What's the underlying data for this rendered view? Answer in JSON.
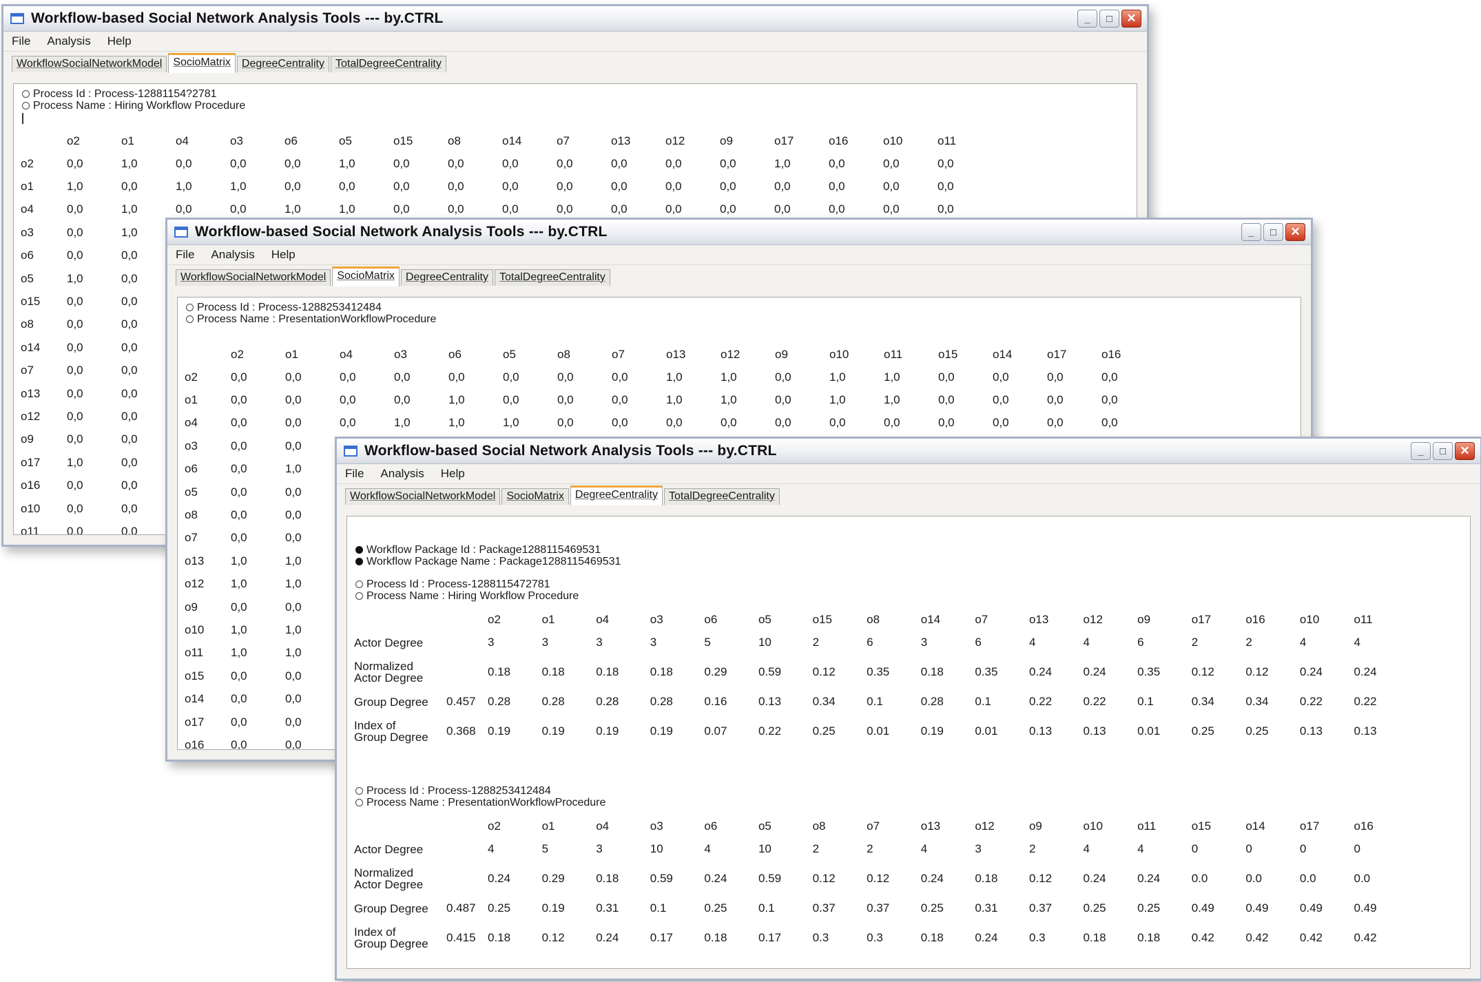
{
  "app": {
    "title": "Workflow-based Social Network Analysis Tools --- by.CTRL",
    "menu": [
      "File",
      "Analysis",
      "Help"
    ],
    "tabs": [
      "WorkflowSocialNetworkModel",
      "SocioMatrix",
      "DegreeCentrality",
      "TotalDegreeCentrality"
    ],
    "controls": {
      "minimize": "_",
      "maximize": "□",
      "close": "✕"
    }
  },
  "window1": {
    "active_tab": "SocioMatrix",
    "process_id_line": "Process Id : Process-12881154?2781",
    "process_name_line": "Process Name : Hiring Workflow Procedure",
    "columns": [
      "o2",
      "o1",
      "o4",
      "o3",
      "o6",
      "o5",
      "o15",
      "o8",
      "o14",
      "o7",
      "o13",
      "o12",
      "o9",
      "o17",
      "o16",
      "o10",
      "o11"
    ],
    "rows": [
      {
        "label": "o2",
        "values": [
          "0,0",
          "1,0",
          "0,0",
          "0,0",
          "0,0",
          "1,0",
          "0,0",
          "0,0",
          "0,0",
          "0,0",
          "0,0",
          "0,0",
          "0,0",
          "1,0",
          "0,0",
          "0,0",
          "0,0"
        ]
      },
      {
        "label": "o1",
        "values": [
          "1,0",
          "0,0",
          "1,0",
          "1,0",
          "0,0",
          "0,0",
          "0,0",
          "0,0",
          "0,0",
          "0,0",
          "0,0",
          "0,0",
          "0,0",
          "0,0",
          "0,0",
          "0,0",
          "0,0"
        ]
      },
      {
        "label": "o4",
        "values": [
          "0,0",
          "1,0",
          "0,0",
          "0,0",
          "1,0",
          "1,0",
          "0,0",
          "0,0",
          "0,0",
          "0,0",
          "0,0",
          "0,0",
          "0,0",
          "0,0",
          "0,0",
          "0,0",
          "0,0"
        ]
      },
      {
        "label": "o3",
        "values": [
          "0,0",
          "1,0"
        ]
      },
      {
        "label": "o6",
        "values": [
          "0,0",
          "0,0"
        ]
      },
      {
        "label": "o5",
        "values": [
          "1,0",
          "0,0"
        ]
      },
      {
        "label": "o15",
        "values": [
          "0,0",
          "0,0"
        ]
      },
      {
        "label": "o8",
        "values": [
          "0,0",
          "0,0"
        ]
      },
      {
        "label": "o14",
        "values": [
          "0,0",
          "0,0"
        ]
      },
      {
        "label": "o7",
        "values": [
          "0,0",
          "0,0"
        ]
      },
      {
        "label": "o13",
        "values": [
          "0,0",
          "0,0"
        ]
      },
      {
        "label": "o12",
        "values": [
          "0,0",
          "0,0"
        ]
      },
      {
        "label": "o9",
        "values": [
          "0,0",
          "0,0"
        ]
      },
      {
        "label": "o17",
        "values": [
          "1,0",
          "0,0"
        ]
      },
      {
        "label": "o16",
        "values": [
          "0,0",
          "0,0"
        ]
      },
      {
        "label": "o10",
        "values": [
          "0,0",
          "0,0"
        ]
      },
      {
        "label": "o11",
        "values": [
          "0,0",
          "0,0"
        ]
      }
    ]
  },
  "window2": {
    "active_tab": "SocioMatrix",
    "process_id_line": "Process Id : Process-1288253412484",
    "process_name_line": "Process Name : PresentationWorkflowProcedure",
    "columns": [
      "o2",
      "o1",
      "o4",
      "o3",
      "o6",
      "o5",
      "o8",
      "o7",
      "o13",
      "o12",
      "o9",
      "o10",
      "o11",
      "o15",
      "o14",
      "o17",
      "o16"
    ],
    "rows": [
      {
        "label": "o2",
        "values": [
          "0,0",
          "0,0",
          "0,0",
          "0,0",
          "0,0",
          "0,0",
          "0,0",
          "0,0",
          "1,0",
          "1,0",
          "0,0",
          "1,0",
          "1,0",
          "0,0",
          "0,0",
          "0,0",
          "0,0"
        ]
      },
      {
        "label": "o1",
        "values": [
          "0,0",
          "0,0",
          "0,0",
          "0,0",
          "1,0",
          "0,0",
          "0,0",
          "0,0",
          "1,0",
          "1,0",
          "0,0",
          "1,0",
          "1,0",
          "0,0",
          "0,0",
          "0,0",
          "0,0"
        ]
      },
      {
        "label": "o4",
        "values": [
          "0,0",
          "0,0",
          "0,0",
          "1,0",
          "1,0",
          "1,0",
          "0,0",
          "0,0",
          "0,0",
          "0,0",
          "0,0",
          "0,0",
          "0,0",
          "0,0",
          "0,0",
          "0,0",
          "0,0"
        ]
      },
      {
        "label": "o3",
        "values": [
          "0,0",
          "0,0"
        ]
      },
      {
        "label": "o6",
        "values": [
          "0,0",
          "1,0"
        ]
      },
      {
        "label": "o5",
        "values": [
          "0,0",
          "0,0"
        ]
      },
      {
        "label": "o8",
        "values": [
          "0,0",
          "0,0"
        ]
      },
      {
        "label": "o7",
        "values": [
          "0,0",
          "0,0"
        ]
      },
      {
        "label": "o13",
        "values": [
          "1,0",
          "1,0"
        ]
      },
      {
        "label": "o12",
        "values": [
          "1,0",
          "1,0"
        ]
      },
      {
        "label": "o9",
        "values": [
          "0,0",
          "0,0"
        ]
      },
      {
        "label": "o10",
        "values": [
          "1,0",
          "1,0"
        ]
      },
      {
        "label": "o11",
        "values": [
          "1,0",
          "1,0"
        ]
      },
      {
        "label": "o15",
        "values": [
          "0,0",
          "0,0"
        ]
      },
      {
        "label": "o14",
        "values": [
          "0,0",
          "0,0"
        ]
      },
      {
        "label": "o17",
        "values": [
          "0,0",
          "0,0"
        ]
      },
      {
        "label": "o16",
        "values": [
          "0,0",
          "0,0"
        ]
      }
    ]
  },
  "window3": {
    "active_tab": "DegreeCentrality",
    "package_id_line": "Workflow Package Id : Package1288115469531",
    "package_name_line": "Workflow Package Name : Package1288115469531",
    "process1": {
      "id_line": "Process Id : Process-1288115472781",
      "name_line": "Process Name : Hiring Workflow Procedure",
      "columns": [
        "o2",
        "o1",
        "o4",
        "o3",
        "o6",
        "o5",
        "o15",
        "o8",
        "o14",
        "o7",
        "o13",
        "o12",
        "o9",
        "o17",
        "o16",
        "o10",
        "o11"
      ],
      "actor_degree_label": "Actor Degree",
      "actor_degree": [
        "3",
        "3",
        "3",
        "3",
        "5",
        "10",
        "2",
        "6",
        "3",
        "6",
        "4",
        "4",
        "6",
        "2",
        "2",
        "4",
        "4"
      ],
      "normalized_label": [
        "Normalized",
        "Actor Degree"
      ],
      "normalized": [
        "0.18",
        "0.18",
        "0.18",
        "0.18",
        "0.29",
        "0.59",
        "0.12",
        "0.35",
        "0.18",
        "0.35",
        "0.24",
        "0.24",
        "0.35",
        "0.12",
        "0.12",
        "0.24",
        "0.24"
      ],
      "group_degree_label": "Group Degree",
      "group_degree_value": "0.457",
      "group_degree": [
        "0.28",
        "0.28",
        "0.28",
        "0.28",
        "0.16",
        "0.13",
        "0.34",
        "0.1",
        "0.28",
        "0.1",
        "0.22",
        "0.22",
        "0.1",
        "0.34",
        "0.34",
        "0.22",
        "0.22"
      ],
      "index_label": [
        "Index of",
        "Group Degree"
      ],
      "index_value": "0.368",
      "index": [
        "0.19",
        "0.19",
        "0.19",
        "0.19",
        "0.07",
        "0.22",
        "0.25",
        "0.01",
        "0.19",
        "0.01",
        "0.13",
        "0.13",
        "0.01",
        "0.25",
        "0.25",
        "0.13",
        "0.13"
      ]
    },
    "process2": {
      "id_line": "Process Id : Process-1288253412484",
      "name_line": "Process Name : PresentationWorkflowProcedure",
      "columns": [
        "o2",
        "o1",
        "o4",
        "o3",
        "o6",
        "o5",
        "o8",
        "o7",
        "o13",
        "o12",
        "o9",
        "o10",
        "o11",
        "o15",
        "o14",
        "o17",
        "o16"
      ],
      "actor_degree_label": "Actor Degree",
      "actor_degree": [
        "4",
        "5",
        "3",
        "10",
        "4",
        "10",
        "2",
        "2",
        "4",
        "3",
        "2",
        "4",
        "4",
        "0",
        "0",
        "0",
        "0"
      ],
      "normalized_label": [
        "Normalized",
        "Actor Degree"
      ],
      "normalized": [
        "0.24",
        "0.29",
        "0.18",
        "0.59",
        "0.24",
        "0.59",
        "0.12",
        "0.12",
        "0.24",
        "0.18",
        "0.12",
        "0.24",
        "0.24",
        "0.0",
        "0.0",
        "0.0",
        "0.0"
      ],
      "group_degree_label": "Group Degree",
      "group_degree_value": "0.487",
      "group_degree": [
        "0.25",
        "0.19",
        "0.31",
        "0.1",
        "0.25",
        "0.1",
        "0.37",
        "0.37",
        "0.25",
        "0.31",
        "0.37",
        "0.25",
        "0.25",
        "0.49",
        "0.49",
        "0.49",
        "0.49"
      ],
      "index_label": [
        "Index of",
        "Group Degree"
      ],
      "index_value": "0.415",
      "index": [
        "0.18",
        "0.12",
        "0.24",
        "0.17",
        "0.18",
        "0.17",
        "0.3",
        "0.3",
        "0.18",
        "0.24",
        "0.3",
        "0.18",
        "0.18",
        "0.42",
        "0.42",
        "0.42",
        "0.42"
      ]
    }
  },
  "colors": {
    "active_tab_accent": "#f0a63a",
    "close_button": "#c8361b",
    "window_border": "#a7b3c6"
  }
}
